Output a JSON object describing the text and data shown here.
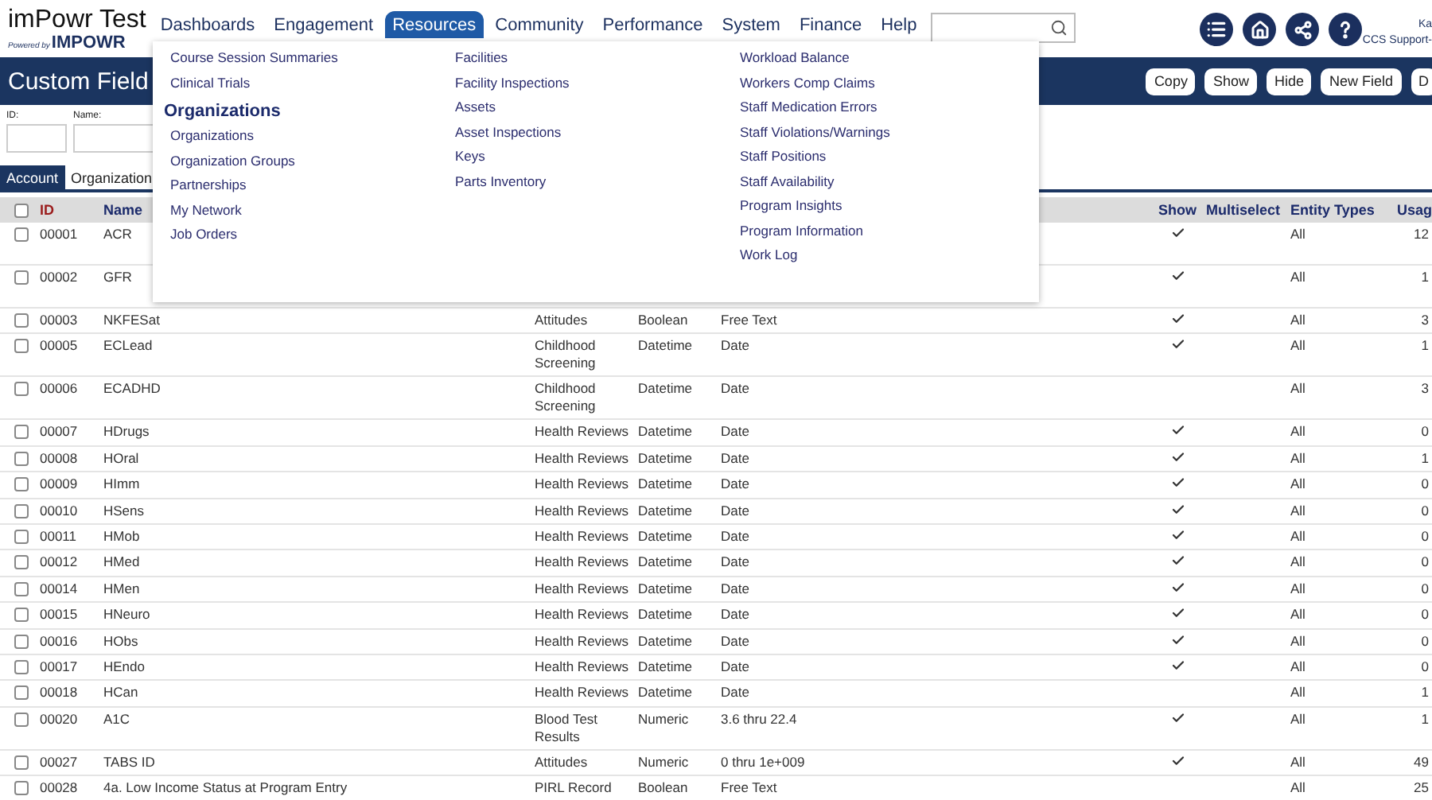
{
  "header": {
    "logo_title": "imPowr Test",
    "logo_powered": "Powered by",
    "logo_brand": "IMPOWR",
    "user_name": "Ka",
    "user_org": "CCS Support-",
    "nav": [
      {
        "label": "Dashboards",
        "selected": false
      },
      {
        "label": "Engagement",
        "selected": false
      },
      {
        "label": "Resources",
        "selected": true
      },
      {
        "label": "Community",
        "selected": false
      },
      {
        "label": "Performance",
        "selected": false
      },
      {
        "label": "System",
        "selected": false
      },
      {
        "label": "Finance",
        "selected": false
      },
      {
        "label": "Help",
        "selected": false
      }
    ]
  },
  "title_bar": {
    "title": "Custom Field",
    "buttons": [
      "Copy",
      "Show",
      "Hide",
      "New Field",
      "D"
    ]
  },
  "filters": [
    {
      "label": "ID:"
    },
    {
      "label": "Name:"
    }
  ],
  "tabs": [
    {
      "label": "Account",
      "selected": true
    },
    {
      "label": "Organization",
      "selected": false
    }
  ],
  "menu": {
    "columns": [
      [
        {
          "kind": "item",
          "label": "Course Session Summaries"
        },
        {
          "kind": "item",
          "label": "Clinical Trials"
        },
        {
          "kind": "heading",
          "label": "Organizations"
        },
        {
          "kind": "item",
          "label": "Organizations"
        },
        {
          "kind": "item",
          "label": "Organization Groups"
        },
        {
          "kind": "item",
          "label": "Partnerships"
        },
        {
          "kind": "item",
          "label": "My Network"
        },
        {
          "kind": "item",
          "label": "Job Orders"
        }
      ],
      [
        {
          "kind": "item",
          "label": "Facilities"
        },
        {
          "kind": "item",
          "label": "Facility Inspections"
        },
        {
          "kind": "item",
          "label": "Assets"
        },
        {
          "kind": "item",
          "label": "Asset Inspections"
        },
        {
          "kind": "item",
          "label": "Keys"
        },
        {
          "kind": "item",
          "label": "Parts Inventory"
        }
      ],
      [
        {
          "kind": "item",
          "label": "Workload Balance"
        },
        {
          "kind": "item",
          "label": "Workers Comp Claims"
        },
        {
          "kind": "item",
          "label": "Staff Medication Errors"
        },
        {
          "kind": "item",
          "label": "Staff Violations/Warnings"
        },
        {
          "kind": "item",
          "label": "Staff Positions"
        },
        {
          "kind": "item",
          "label": "Staff Availability"
        },
        {
          "kind": "item",
          "label": "Program Insights"
        },
        {
          "kind": "item",
          "label": "Program Information"
        },
        {
          "kind": "item",
          "label": "Work Log"
        }
      ]
    ]
  },
  "table": {
    "select_all": {
      "checked": false
    },
    "columns": {
      "id": {
        "label": "ID",
        "sorted": true
      },
      "name": {
        "label": "Name",
        "sorted": false
      },
      "show": {
        "label": "Show",
        "sorted": false
      },
      "multiselect": {
        "label": "Multiselect",
        "sorted": false
      },
      "entity_types": {
        "label": "Entity Types",
        "sorted": false
      },
      "usage": {
        "label": "Usag",
        "sorted": false
      }
    },
    "rows": [
      {
        "checked": false,
        "id": "00001",
        "name": "ACR",
        "show": true,
        "entity_types": "All",
        "usage": "12"
      },
      {
        "checked": false,
        "id": "00002",
        "name": "GFR",
        "show": true,
        "entity_types": "All",
        "usage": "1"
      },
      {
        "checked": false,
        "id": "00003",
        "name": "NKFESat",
        "category": "Attitudes",
        "type": "Boolean",
        "format": "Free Text",
        "show": true,
        "entity_types": "All",
        "usage": "3"
      },
      {
        "checked": false,
        "id": "00005",
        "name": "ECLead",
        "category": "Childhood Screening",
        "type": "Datetime",
        "format": "Date",
        "show": true,
        "entity_types": "All",
        "usage": "1"
      },
      {
        "checked": false,
        "id": "00006",
        "name": "ECADHD",
        "category": "Childhood Screening",
        "type": "Datetime",
        "format": "Date",
        "show": false,
        "entity_types": "All",
        "usage": "3"
      },
      {
        "checked": false,
        "id": "00007",
        "name": "HDrugs",
        "category": "Health Reviews",
        "type": "Datetime",
        "format": "Date",
        "show": true,
        "entity_types": "All",
        "usage": "0"
      },
      {
        "checked": false,
        "id": "00008",
        "name": "HOral",
        "category": "Health Reviews",
        "type": "Datetime",
        "format": "Date",
        "show": true,
        "entity_types": "All",
        "usage": "1"
      },
      {
        "checked": false,
        "id": "00009",
        "name": "HImm",
        "category": "Health Reviews",
        "type": "Datetime",
        "format": "Date",
        "show": true,
        "entity_types": "All",
        "usage": "0"
      },
      {
        "checked": false,
        "id": "00010",
        "name": "HSens",
        "category": "Health Reviews",
        "type": "Datetime",
        "format": "Date",
        "show": true,
        "entity_types": "All",
        "usage": "0"
      },
      {
        "checked": false,
        "id": "00011",
        "name": "HMob",
        "category": "Health Reviews",
        "type": "Datetime",
        "format": "Date",
        "show": true,
        "entity_types": "All",
        "usage": "0"
      },
      {
        "checked": false,
        "id": "00012",
        "name": "HMed",
        "category": "Health Reviews",
        "type": "Datetime",
        "format": "Date",
        "show": true,
        "entity_types": "All",
        "usage": "0"
      },
      {
        "checked": false,
        "id": "00014",
        "name": "HMen",
        "category": "Health Reviews",
        "type": "Datetime",
        "format": "Date",
        "show": true,
        "entity_types": "All",
        "usage": "0"
      },
      {
        "checked": false,
        "id": "00015",
        "name": "HNeuro",
        "category": "Health Reviews",
        "type": "Datetime",
        "format": "Date",
        "show": true,
        "entity_types": "All",
        "usage": "0"
      },
      {
        "checked": false,
        "id": "00016",
        "name": "HObs",
        "category": "Health Reviews",
        "type": "Datetime",
        "format": "Date",
        "show": true,
        "entity_types": "All",
        "usage": "0"
      },
      {
        "checked": false,
        "id": "00017",
        "name": "HEndo",
        "category": "Health Reviews",
        "type": "Datetime",
        "format": "Date",
        "show": true,
        "entity_types": "All",
        "usage": "0"
      },
      {
        "checked": false,
        "id": "00018",
        "name": "HCan",
        "category": "Health Reviews",
        "type": "Datetime",
        "format": "Date",
        "show": false,
        "entity_types": "All",
        "usage": "1"
      },
      {
        "checked": false,
        "id": "00020",
        "name": "A1C",
        "category": "Blood Test Results",
        "type": "Numeric",
        "format": "3.6 thru 22.4",
        "show": true,
        "entity_types": "All",
        "usage": "1"
      },
      {
        "checked": false,
        "id": "00027",
        "name": "TABS ID",
        "category": "Attitudes",
        "type": "Numeric",
        "format": "0 thru 1e+009",
        "show": true,
        "entity_types": "All",
        "usage": "49"
      },
      {
        "checked": false,
        "id": "00028",
        "name": "4a. Low Income Status at Program Entry",
        "category": "PIRL Record",
        "type": "Boolean",
        "format": "Free Text",
        "show": false,
        "entity_types": "All",
        "usage": "25"
      }
    ]
  }
}
